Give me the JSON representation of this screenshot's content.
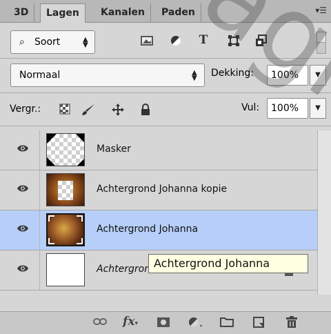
{
  "tabs": [
    {
      "label": "3D"
    },
    {
      "label": "Lagen"
    },
    {
      "label": "Kanalen"
    },
    {
      "label": "Paden"
    }
  ],
  "filter": {
    "kind_label": "Soort"
  },
  "blend": {
    "mode": "Normaal",
    "opacity_label": "Dekking:",
    "opacity_value": "100%"
  },
  "lock": {
    "label": "Vergr.:",
    "fill_label": "Vul:",
    "fill_value": "100%"
  },
  "layers": [
    {
      "name": "Masker",
      "italic": false,
      "selected": false
    },
    {
      "name": "Achtergrond Johanna kopie",
      "italic": false,
      "selected": false
    },
    {
      "name": "Achtergrond Johanna",
      "italic": false,
      "selected": true
    },
    {
      "name": "Achtergrond",
      "italic": true,
      "selected": false
    }
  ],
  "tooltip": "Achtergrond Johanna",
  "watermark": "gragroep",
  "colors": {
    "selected_row": "#b6cef8",
    "tooltip_bg": "#ffffe1",
    "watermark": "#3a3a3a"
  }
}
